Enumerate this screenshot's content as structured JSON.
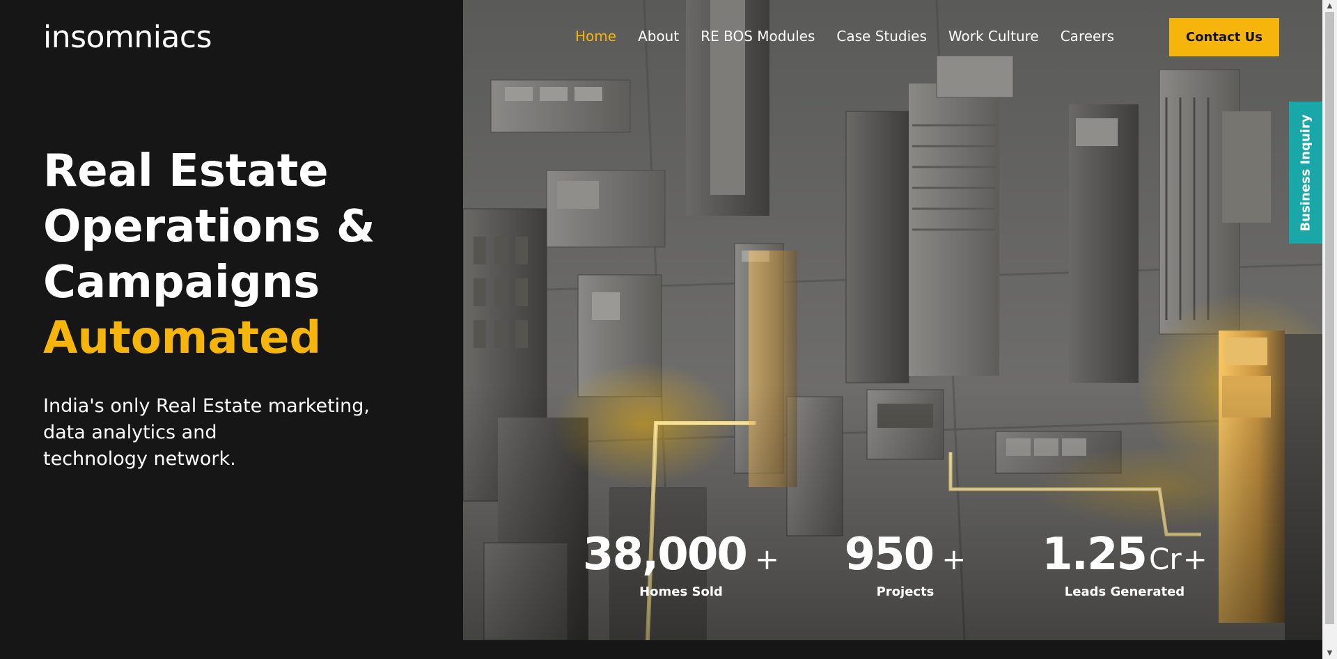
{
  "brand": {
    "logo_text": "insomniacs"
  },
  "nav": {
    "items": [
      {
        "label": "Home",
        "active": true
      },
      {
        "label": "About"
      },
      {
        "label": "RE BOS Modules"
      },
      {
        "label": "Case Studies"
      },
      {
        "label": "Work Culture"
      },
      {
        "label": "Careers"
      }
    ],
    "contact_label": "Contact Us"
  },
  "side_tab": {
    "label": "Business Inquiry"
  },
  "hero": {
    "headline": [
      "Real Estate",
      "Operations &",
      "Campaigns"
    ],
    "headline_accent": "Automated",
    "tagline": [
      "India's only Real Estate marketing,",
      "data analytics and",
      "technology network."
    ]
  },
  "stats": [
    {
      "number": "38,000",
      "unit": "",
      "suffix": "+",
      "label": "Homes Sold"
    },
    {
      "number": "950",
      "unit": "",
      "suffix": "+",
      "label": "Projects"
    },
    {
      "number": "1.25",
      "unit": "Cr",
      "suffix": "+",
      "label": "Leads Generated"
    }
  ],
  "colors": {
    "accent": "#f5b50b",
    "background": "#161616",
    "side_tab": "#1aa7a8"
  }
}
